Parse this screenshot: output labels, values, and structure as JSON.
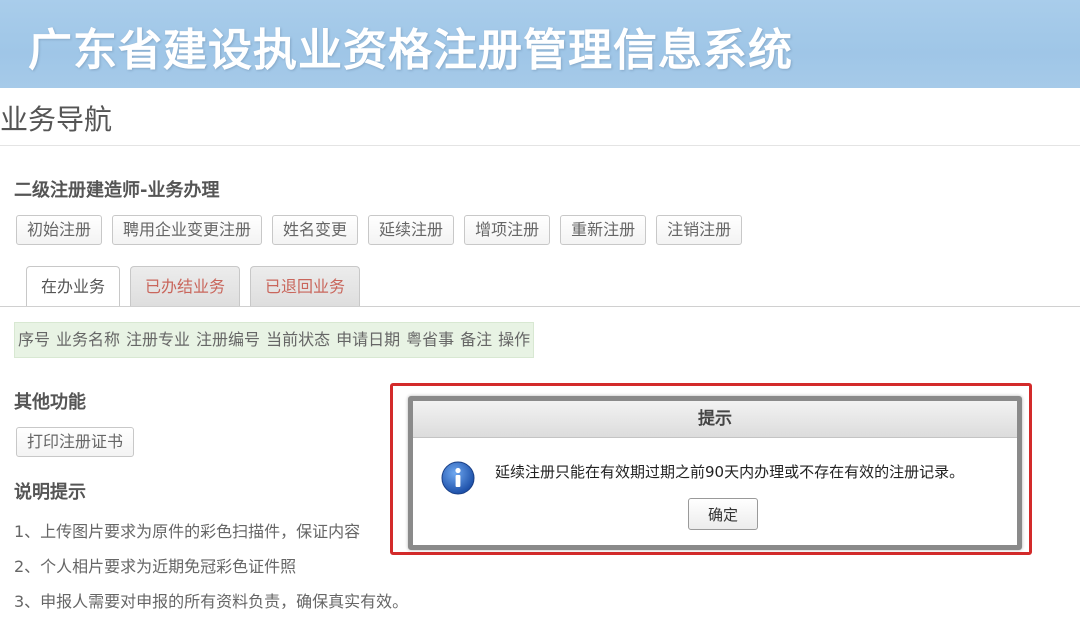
{
  "header": {
    "title": "广东省建设执业资格注册管理信息系统"
  },
  "nav": {
    "title": "业务导航"
  },
  "business": {
    "section_title": "二级注册建造师-业务办理",
    "buttons": [
      "初始注册",
      "聘用企业变更注册",
      "姓名变更",
      "延续注册",
      "增项注册",
      "重新注册",
      "注销注册"
    ]
  },
  "tabs": [
    "在办业务",
    "已办结业务",
    "已退回业务"
  ],
  "table": {
    "columns": [
      "序号",
      "业务名称",
      "注册专业",
      "注册编号",
      "当前状态",
      "申请日期",
      "粤省事",
      "备注",
      "操作"
    ]
  },
  "other": {
    "title": "其他功能",
    "print_button": "打印注册证书"
  },
  "notes": {
    "title": "说明提示",
    "items": [
      "1、上传图片要求为原件的彩色扫描件，保证内容",
      "2、个人相片要求为近期免冠彩色证件照",
      "3、申报人需要对申报的所有资料负责，确保真实有效。"
    ]
  },
  "dialog": {
    "title": "提示",
    "message": "延续注册只能在有效期过期之前90天内办理或不存在有效的注册记录。",
    "ok_label": "确定",
    "icon": "info-icon"
  },
  "colors": {
    "header_bg": "#a6cae9",
    "highlight_frame": "#d32a2a",
    "inactive_tab_text": "#c9665c"
  }
}
